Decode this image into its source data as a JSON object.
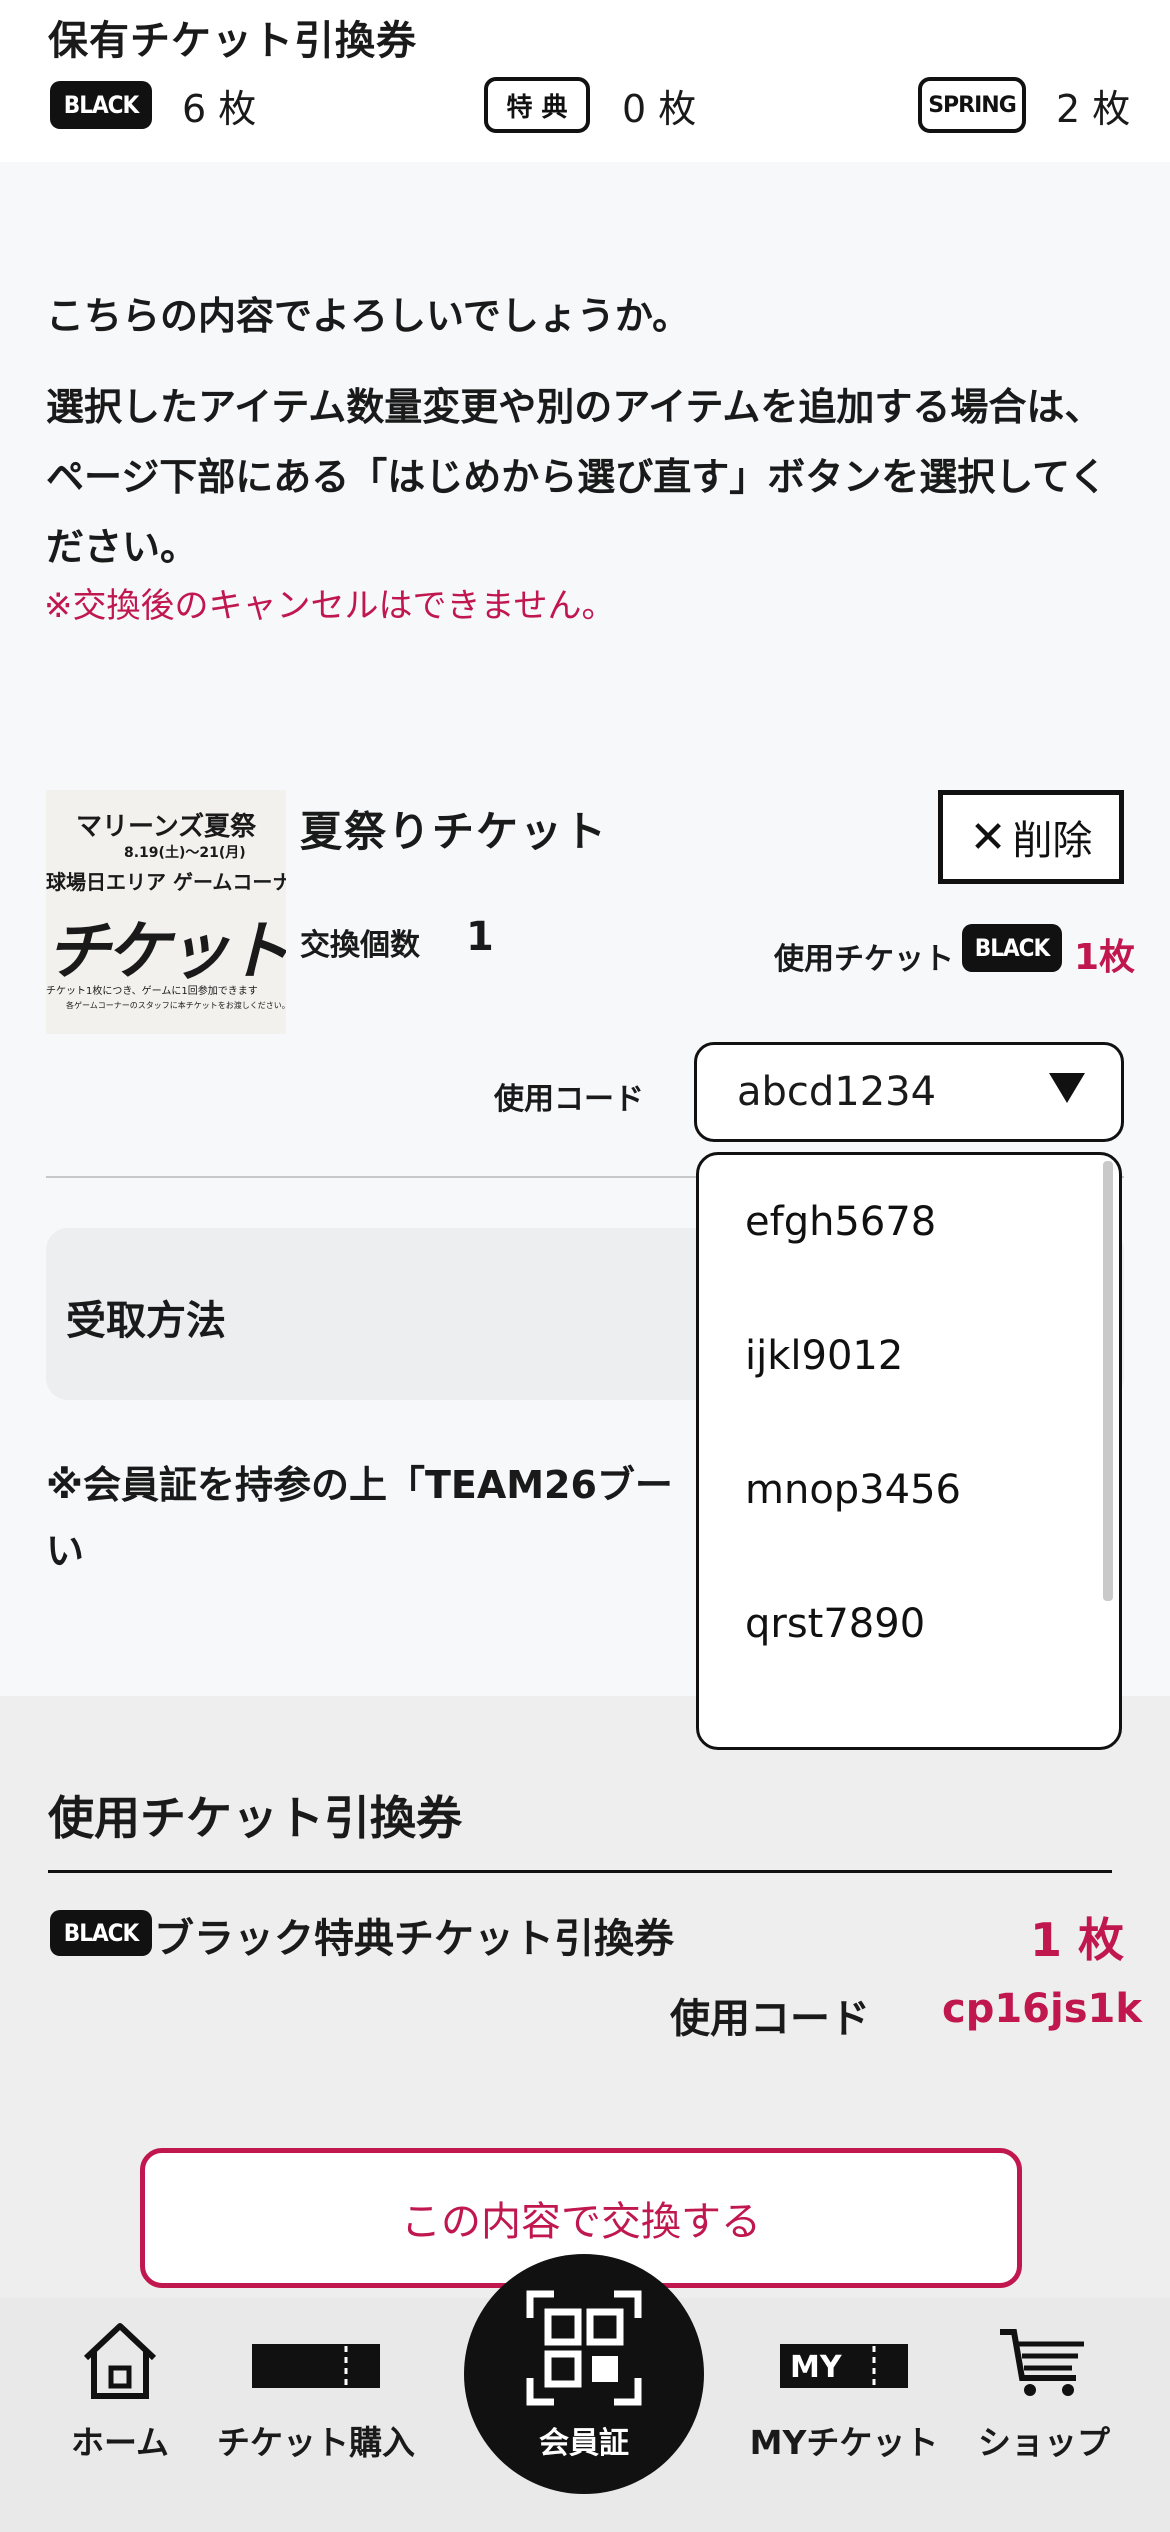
{
  "header": {
    "title": "保有チケット引換券",
    "tickets": [
      {
        "badge": "BLACK",
        "count": "6 枚"
      },
      {
        "badge": "特 典",
        "count": "0 枚"
      },
      {
        "badge": "SPRING",
        "count": "2 枚"
      }
    ]
  },
  "confirm": {
    "question": "こちらの内容でよろしいでしょうか。",
    "body": "選択したアイテム数量変更や別のアイテムを追加する場合は、ページ下部にある「はじめから選び直す」ボタンを選択してください。",
    "notice": "※交換後のキャンセルはできません。"
  },
  "item": {
    "name": "夏祭りチケット",
    "delete_label": "削除",
    "qty_label": "交換個数",
    "qty_value": "1",
    "use_ticket_label": "使用チケット",
    "use_ticket_badge": "BLACK",
    "use_ticket_count": "1枚",
    "code_label": "使用コード",
    "code_selected": "abcd1234",
    "thumb": {
      "line1": "マリーンズ夏祭",
      "line2": "8.19(土)〜21(月)",
      "line3": "球場日エリア ゲームコーナー",
      "line4": "チケット",
      "line5": "チケット1枚につき、ゲームに1回参加できます",
      "line6": "各ゲームコーナーのスタッフに本チケットをお渡しください。"
    }
  },
  "dropdown": {
    "options": [
      "efgh5678",
      "ijkl9012",
      "mnop3456",
      "qrst7890"
    ]
  },
  "receive": {
    "label": "受取方法",
    "note": "※会員証を持参の上「TEAM26ブー",
    "note2": "い"
  },
  "used_tickets": {
    "title": "使用チケット引換券",
    "badge": "BLACK",
    "name": "ブラック特典チケット引換券",
    "count": "1 枚",
    "code_label": "使用コード",
    "code_value": "cp16js1k"
  },
  "submit_label": "この内容で交換する",
  "nav": {
    "home": "ホーム",
    "buy": "チケット購入",
    "member": "会員証",
    "my": "MYチケット",
    "shop": "ショップ",
    "my_badge": "MY"
  },
  "colors": {
    "accent": "#c0174f",
    "dark": "#111111"
  }
}
